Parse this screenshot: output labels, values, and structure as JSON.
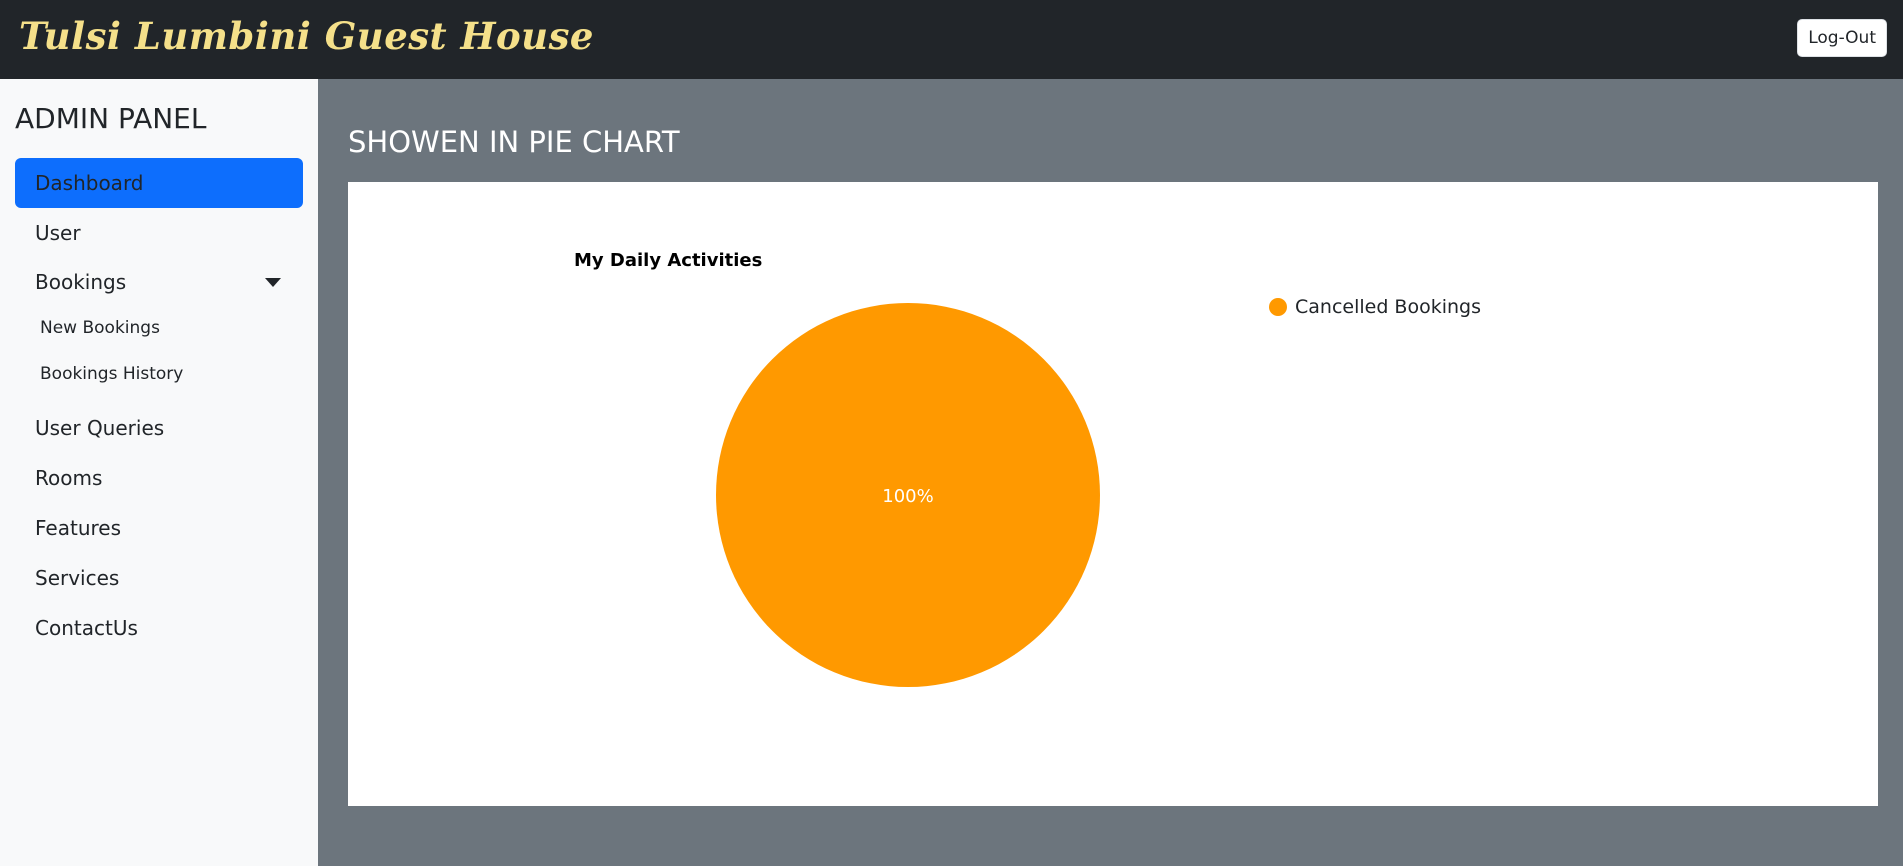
{
  "header": {
    "brand": "Tulsi Lumbini Guest House",
    "logout_label": "Log-Out"
  },
  "sidebar": {
    "title": "ADMIN PANEL",
    "items": [
      {
        "label": "Dashboard",
        "active": true
      },
      {
        "label": "User"
      },
      {
        "label": "Bookings",
        "expanded": true
      },
      {
        "label": "User Queries"
      },
      {
        "label": "Rooms"
      },
      {
        "label": "Features"
      },
      {
        "label": "Services"
      },
      {
        "label": "ContactUs"
      }
    ],
    "bookings_sub": [
      {
        "label": "New Bookings"
      },
      {
        "label": "Bookings History"
      }
    ]
  },
  "main": {
    "title": "SHOWEN IN PIE CHART"
  },
  "chart_data": {
    "type": "pie",
    "title": "My Daily Activities",
    "slices": [
      {
        "label": "Cancelled Bookings",
        "value": 100,
        "color": "#ff9900",
        "data_label": "100%"
      }
    ],
    "legend_position": "right"
  }
}
